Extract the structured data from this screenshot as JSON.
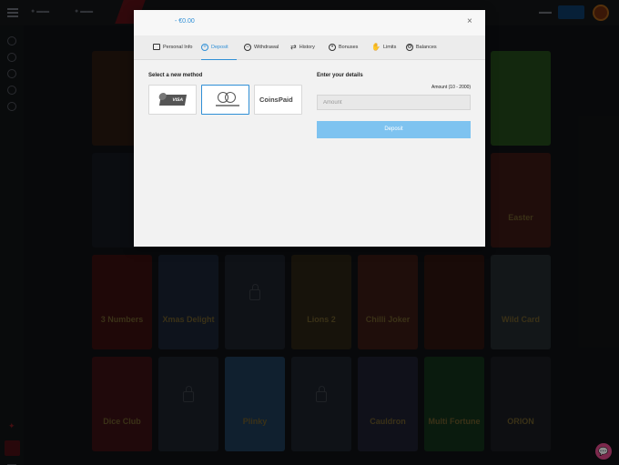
{
  "modal": {
    "balance": "- €0.00",
    "close_glyph": "×",
    "tabs": [
      {
        "label": "Personal Info",
        "icon": "id-card-icon"
      },
      {
        "label": "Deposit",
        "icon": "plus-circle-icon"
      },
      {
        "label": "Withdrawal",
        "icon": "minus-circle-icon"
      },
      {
        "label": "History",
        "icon": "arrows-icon"
      },
      {
        "label": "Bonuses",
        "icon": "target-icon"
      },
      {
        "label": "Limits",
        "icon": "hand-icon"
      },
      {
        "label": "Balances",
        "icon": "gear-icon"
      }
    ],
    "active_tab": "Deposit",
    "select_method_title": "Select a new method",
    "methods": [
      {
        "name": "Visa",
        "logo_text": "VISA"
      },
      {
        "name": "Mastercard",
        "logo_text": ""
      },
      {
        "name": "CoinsPaid",
        "logo_text": "CoinsPaid"
      }
    ],
    "selected_method": "Mastercard",
    "details_title": "Enter your details",
    "amount_range": "Amount (10 - 2000)",
    "amount_placeholder": "Amount",
    "deposit_button": "Deposit"
  },
  "background": {
    "accent_blue": "#2f8fd6",
    "deposit_button_color": "#7ec3f0",
    "tiles": [
      {
        "label": "",
        "locked": false,
        "color": "#2a1a12"
      },
      {
        "label": "3 Numbers",
        "locked": false,
        "color": "#3a0f10"
      },
      {
        "label": "Xmas Delight",
        "locked": false,
        "color": "#1b2433"
      },
      {
        "label": "",
        "locked": true,
        "color": "#1c222b"
      },
      {
        "label": "Lions 2",
        "locked": false,
        "color": "#2a2315"
      },
      {
        "label": "Chilli Joker",
        "locked": false,
        "color": "#3a1a14"
      },
      {
        "label": "",
        "locked": false,
        "color": "#2e1410"
      },
      {
        "label": "Wild Card",
        "locked": false,
        "color": "#242a2e"
      },
      {
        "label": "Dice Club",
        "locked": false,
        "color": "#3b1115"
      },
      {
        "label": "",
        "locked": true,
        "color": "#1c222b"
      },
      {
        "label": "Plinky",
        "locked": false,
        "color": "#1e3b56"
      },
      {
        "label": "",
        "locked": true,
        "color": "#1c222b"
      },
      {
        "label": "Cauldron",
        "locked": false,
        "color": "#1e2030"
      },
      {
        "label": "Multi Fortune",
        "locked": false,
        "color": "#13321a"
      },
      {
        "label": "ORION",
        "locked": false,
        "color": "#1a1d22"
      },
      {
        "label": "Easter",
        "locked": false,
        "color": "#3b1814"
      }
    ]
  }
}
